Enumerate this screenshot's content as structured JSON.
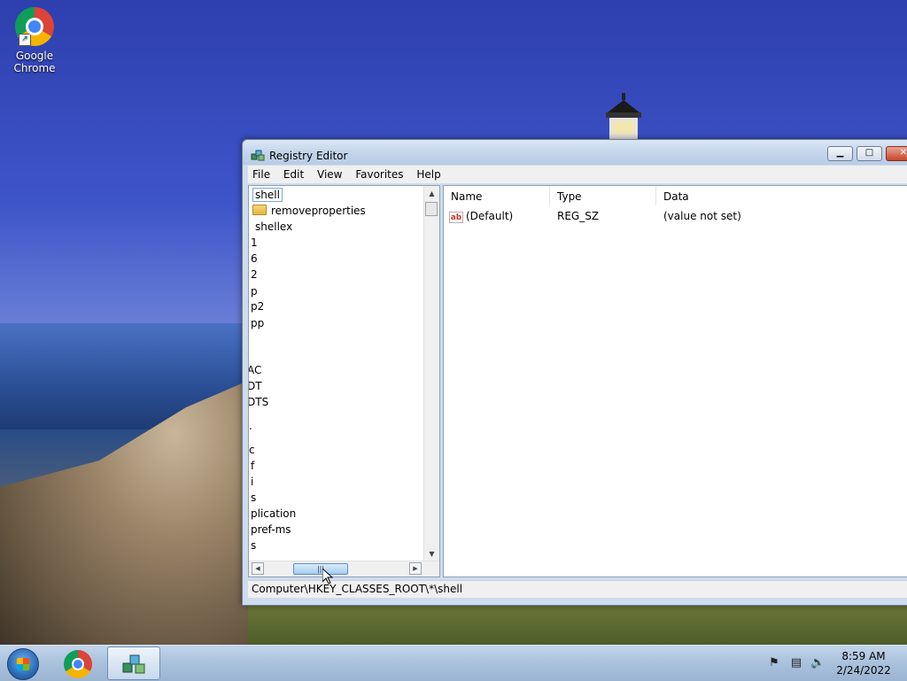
{
  "desktop": {
    "icons": [
      {
        "label_line1": "Google",
        "label_line2": "Chrome",
        "icon": "chrome-icon"
      }
    ]
  },
  "window": {
    "title": "Registry Editor",
    "icon": "regedit-icon",
    "controls": {
      "minimize": "minimize-icon",
      "maximize": "maximize-icon",
      "close": "close-icon"
    },
    "menu": [
      "File",
      "Edit",
      "View",
      "Favorites",
      "Help"
    ],
    "tree": [
      {
        "label": "shell",
        "selected": true,
        "folder": false
      },
      {
        "label": "removeproperties",
        "selected": false,
        "folder": true
      },
      {
        "label": "shellex",
        "selected": false,
        "folder": false
      },
      {
        "label": "1"
      },
      {
        "label": "6"
      },
      {
        "label": "2"
      },
      {
        "label": "p"
      },
      {
        "label": "p2"
      },
      {
        "label": "pp"
      },
      {
        "label": "AC"
      },
      {
        "label": "DT"
      },
      {
        "label": "DTS"
      },
      {
        "label": "."
      },
      {
        "label": "c"
      },
      {
        "label": "f"
      },
      {
        "label": "i"
      },
      {
        "label": "s"
      },
      {
        "label": "plication"
      },
      {
        "label": "pref-ms"
      },
      {
        "label": "s"
      }
    ],
    "columns": [
      "Name",
      "Type",
      "Data"
    ],
    "values": [
      {
        "name": "(Default)",
        "type": "REG_SZ",
        "data": "(value not set)",
        "icon": "string-value-icon"
      }
    ],
    "statusbar": "Computer\\HKEY_CLASSES_ROOT\\*\\shell"
  },
  "taskbar": {
    "time": "8:59 AM",
    "date": "2/24/2022",
    "tray_icons": [
      "action-center-icon",
      "network-icon",
      "volume-icon"
    ]
  }
}
